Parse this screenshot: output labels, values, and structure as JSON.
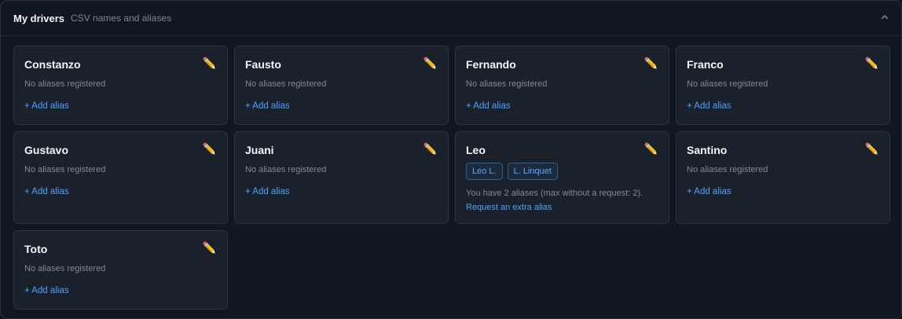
{
  "header": {
    "title": "My drivers",
    "subtitle": "CSV names and aliases"
  },
  "icons": {
    "edit": "✏️",
    "collapse": "chevron-up-icon"
  },
  "drivers": [
    {
      "name": "Constanzo",
      "no_alias_text": "No aliases registered",
      "add_alias_label": "+ Add alias"
    },
    {
      "name": "Fausto",
      "no_alias_text": "No aliases registered",
      "add_alias_label": "+ Add alias"
    },
    {
      "name": "Fernando",
      "no_alias_text": "No aliases registered",
      "add_alias_label": "+ Add alias"
    },
    {
      "name": "Franco",
      "no_alias_text": "No aliases registered",
      "add_alias_label": "+ Add alias"
    },
    {
      "name": "Gustavo",
      "no_alias_text": "No aliases registered",
      "add_alias_label": "+ Add alias"
    },
    {
      "name": "Juani",
      "no_alias_text": "No aliases registered",
      "add_alias_label": "+ Add alias"
    },
    {
      "name": "Leo",
      "aliases": [
        "Leo L.",
        "L. Linquet"
      ],
      "info_text": "You have 2 aliases (max without a request: 2).",
      "request_label": "Request an extra alias"
    },
    {
      "name": "Santino",
      "no_alias_text": "No aliases registered",
      "add_alias_label": "+ Add alias"
    },
    {
      "name": "Toto",
      "no_alias_text": "No aliases registered",
      "add_alias_label": "+ Add alias"
    }
  ],
  "colors": {
    "accent": "#4aa3ff",
    "background": "#111720",
    "card": "#1a212b"
  }
}
